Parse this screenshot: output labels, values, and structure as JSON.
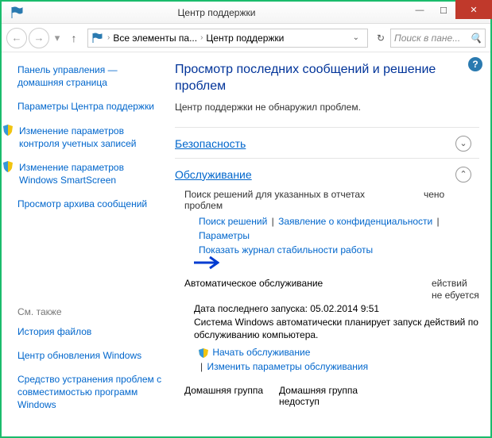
{
  "window": {
    "title": "Центр поддержки"
  },
  "breadcrumb": {
    "part1": "Все элементы па...",
    "part2": "Центр поддержки"
  },
  "search": {
    "placeholder": "Поиск в пане..."
  },
  "sidebar": {
    "items": [
      "Панель управления — домашняя страница",
      "Параметры Центра поддержки",
      "Изменение параметров контроля учетных записей",
      "Изменение параметров Windows SmartScreen",
      "Просмотр архива сообщений"
    ],
    "seealso_label": "См. также",
    "seealso": [
      "История файлов",
      "Центр обновления Windows",
      "Средство устранения проблем с совместимостью программ Windows"
    ]
  },
  "main": {
    "heading": "Просмотр последних сообщений и решение проблем",
    "sub": "Центр поддержки не обнаружил проблем.",
    "security": "Безопасность",
    "maint": "Обслуживание",
    "search_solutions_label": "Поиск решений для указанных в отчетах проблем",
    "search_right": "чено",
    "links": {
      "search": "Поиск решений",
      "privacy": "Заявление о конфиденциальности",
      "params": "Параметры",
      "reliability": "Показать журнал стабильности работы"
    },
    "automaint_label": "Автоматическое обслуживание",
    "automaint_right": "ействий не ебуется",
    "last_run": "Дата последнего запуска: 05.02.2014 9:51",
    "automaint_text": "Система Windows автоматически планирует запуск действий по обслуживанию компьютера.",
    "start_maint": "Начать обслуживание",
    "change_maint": "Изменить параметры обслуживания",
    "homegroup1": "Домашняя группа",
    "homegroup2": "Домашняя группа недоступ"
  }
}
